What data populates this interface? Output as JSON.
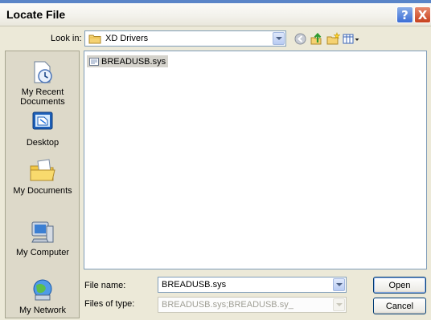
{
  "window": {
    "title": "Locate File"
  },
  "titlebar": {
    "help_glyph": "?",
    "close_glyph": "X"
  },
  "lookin": {
    "label": "Look in:",
    "value": "XD Drivers"
  },
  "toolbar": [
    "back-icon",
    "up-folder-icon",
    "new-folder-icon",
    "views-menu-icon"
  ],
  "places": [
    {
      "label": "My Recent Documents",
      "icon": "recent-documents-icon"
    },
    {
      "label": "Desktop",
      "icon": "desktop-icon"
    },
    {
      "label": "My Documents",
      "icon": "my-documents-icon"
    },
    {
      "label": "My Computer",
      "icon": "my-computer-icon"
    },
    {
      "label": "My Network",
      "icon": "my-network-icon"
    }
  ],
  "files": [
    {
      "name": "BREADUSB.sys",
      "selected": true
    }
  ],
  "filename": {
    "label": "File name:",
    "value": "BREADUSB.sys"
  },
  "filetype": {
    "label": "Files of type:",
    "value": "BREADUSB.sys;BREADUSB.sy_"
  },
  "buttons": {
    "open": "Open",
    "cancel": "Cancel"
  },
  "colors": {
    "dialog_bg": "#ece9d8",
    "places_bg": "#ddd9c9",
    "border_blue": "#7f9db9",
    "close_red": "#c6401d"
  }
}
